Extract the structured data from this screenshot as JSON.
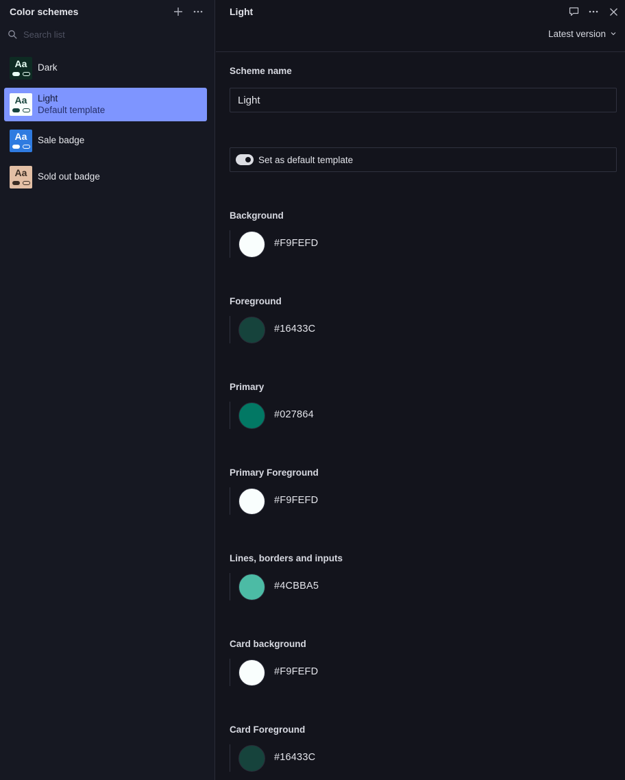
{
  "sidebar": {
    "title": "Color schemes",
    "add_icon": "plus-icon",
    "more_icon": "more-horizontal-icon",
    "search": {
      "placeholder": "Search list",
      "icon": "search-icon"
    },
    "items": [
      {
        "label": "Dark",
        "subtitle": "",
        "thumb": {
          "bg": "#0e2b23",
          "fg": "#e8fff5",
          "pill_a": "#e8fff5",
          "pill_b_border": "#e8fff5"
        }
      },
      {
        "label": "Light",
        "subtitle": "Default template",
        "selected": true,
        "thumb": {
          "bg": "#f9fefd",
          "fg": "#16433c",
          "pill_a": "#16433c",
          "pill_b_border": "#16433c"
        }
      },
      {
        "label": "Sale badge",
        "subtitle": "",
        "thumb": {
          "bg": "#2f7be0",
          "fg": "#ffffff",
          "pill_a": "#ffffff",
          "pill_b_border": "#ffffff"
        }
      },
      {
        "label": "Sold out badge",
        "subtitle": "",
        "thumb": {
          "bg": "#e3bfa5",
          "fg": "#3b2d24",
          "pill_a": "#3b2d24",
          "pill_b_border": "#3b2d24"
        }
      }
    ]
  },
  "main": {
    "title": "Light",
    "comment_icon": "comment-icon",
    "more_icon": "more-horizontal-icon",
    "close_icon": "close-icon",
    "version_label": "Latest version",
    "version_icon": "chevron-down-icon",
    "scheme_name_label": "Scheme name",
    "scheme_name_value": "Light",
    "default_toggle_label": "Set as default template",
    "default_toggle_on": true,
    "colors": [
      {
        "label": "Background",
        "hex": "#F9FEFD"
      },
      {
        "label": "Foreground",
        "hex": "#16433C"
      },
      {
        "label": "Primary",
        "hex": "#027864"
      },
      {
        "label": "Primary Foreground",
        "hex": "#F9FEFD"
      },
      {
        "label": "Lines, borders and inputs",
        "hex": "#4CBBA5"
      },
      {
        "label": "Card background",
        "hex": "#F9FEFD"
      },
      {
        "label": "Card Foreground",
        "hex": "#16433C"
      }
    ]
  }
}
